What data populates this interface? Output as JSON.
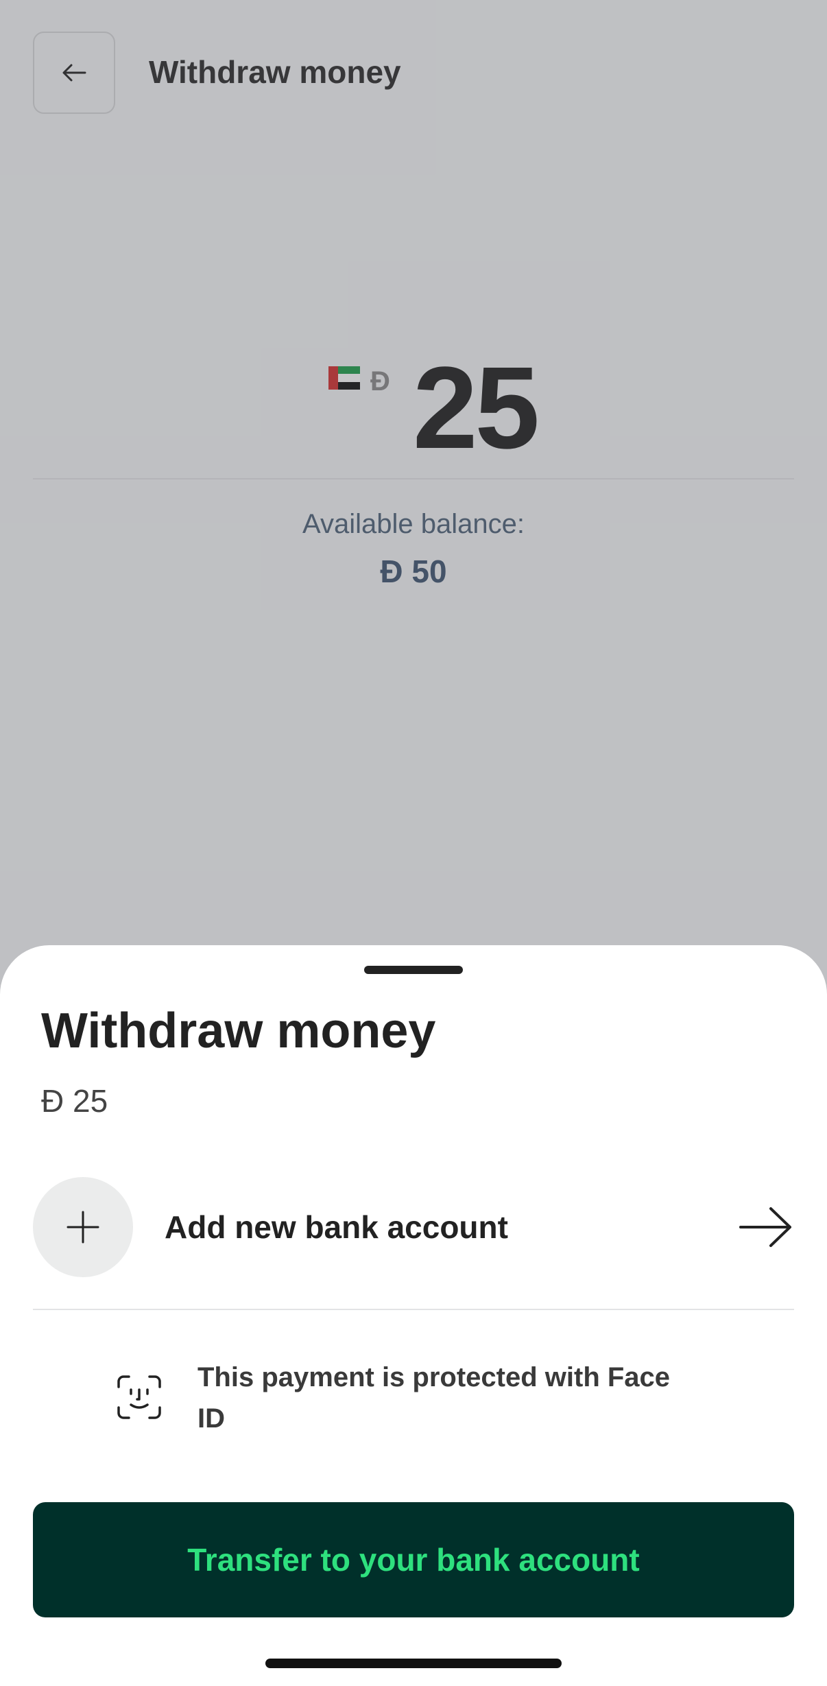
{
  "background": {
    "title": "Withdraw money",
    "currency_symbol": "Ð",
    "amount": "25",
    "available_label": "Available balance:",
    "available_value": "Ð 50"
  },
  "sheet": {
    "title": "Withdraw money",
    "amount": "Ð 25",
    "add_bank_label": "Add new bank account",
    "faceid_text": "This payment is protected with Face ID",
    "transfer_button": "Transfer to your bank account"
  },
  "colors": {
    "button_bg": "#00302a",
    "button_text": "#2ee07e"
  },
  "icons": {
    "back": "arrow-left-icon",
    "plus": "plus-icon",
    "forward": "arrow-right-icon",
    "faceid": "face-id-icon",
    "flag": "uae-flag-icon"
  }
}
